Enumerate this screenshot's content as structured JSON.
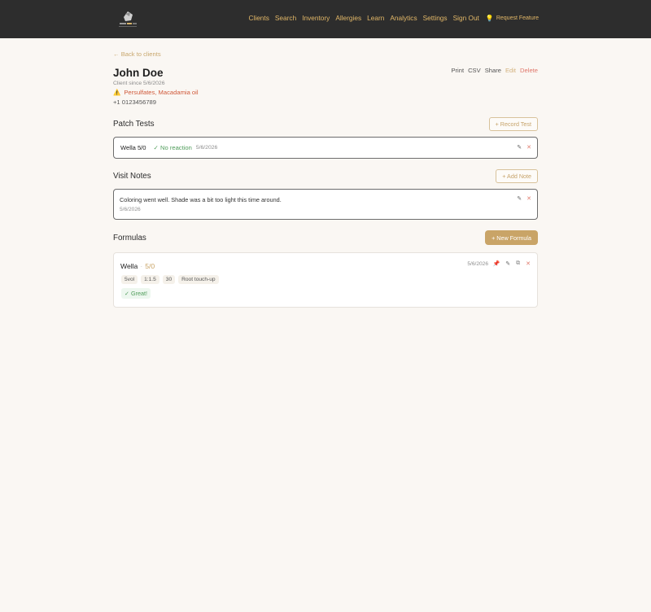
{
  "nav": {
    "items": [
      "Clients",
      "Search",
      "Inventory",
      "Allergies",
      "Learn",
      "Analytics",
      "Settings",
      "Sign Out"
    ],
    "request_feature": "Request Feature",
    "request_icon": "lightbulb-icon"
  },
  "back_link": "← Back to clients",
  "client": {
    "name": "John Doe",
    "since": "Client since 5/6/2026",
    "allergies": "Persulfates, Macadamia oil",
    "phone": "+1 0123456789"
  },
  "actions": {
    "print": "Print",
    "csv": "CSV",
    "share": "Share",
    "edit": "Edit",
    "delete": "Delete"
  },
  "patch_tests": {
    "title": "Patch Tests",
    "button": "+ Record Test",
    "items": [
      {
        "name": "Wella 5/0",
        "result": "✓ No reaction",
        "date": "5/6/2026"
      }
    ]
  },
  "visit_notes": {
    "title": "Visit Notes",
    "button": "+ Add Note",
    "items": [
      {
        "text": "Coloring went well. Shade was a bit too light this time around.",
        "date": "5/6/2026"
      }
    ]
  },
  "formulas": {
    "title": "Formulas",
    "button": "+ New Formula",
    "items": [
      {
        "brand": "Wella",
        "shade": "5/0",
        "date": "5/6/2026",
        "tags": [
          "5vol",
          "1:1.5",
          "30",
          "Root touch-up"
        ],
        "rating": "✓ Great!"
      }
    ]
  },
  "colors": {
    "accent": "#c9a467",
    "nav_bg": "#2d2d2d",
    "danger": "#e0776b",
    "success": "#4f9c5a"
  }
}
